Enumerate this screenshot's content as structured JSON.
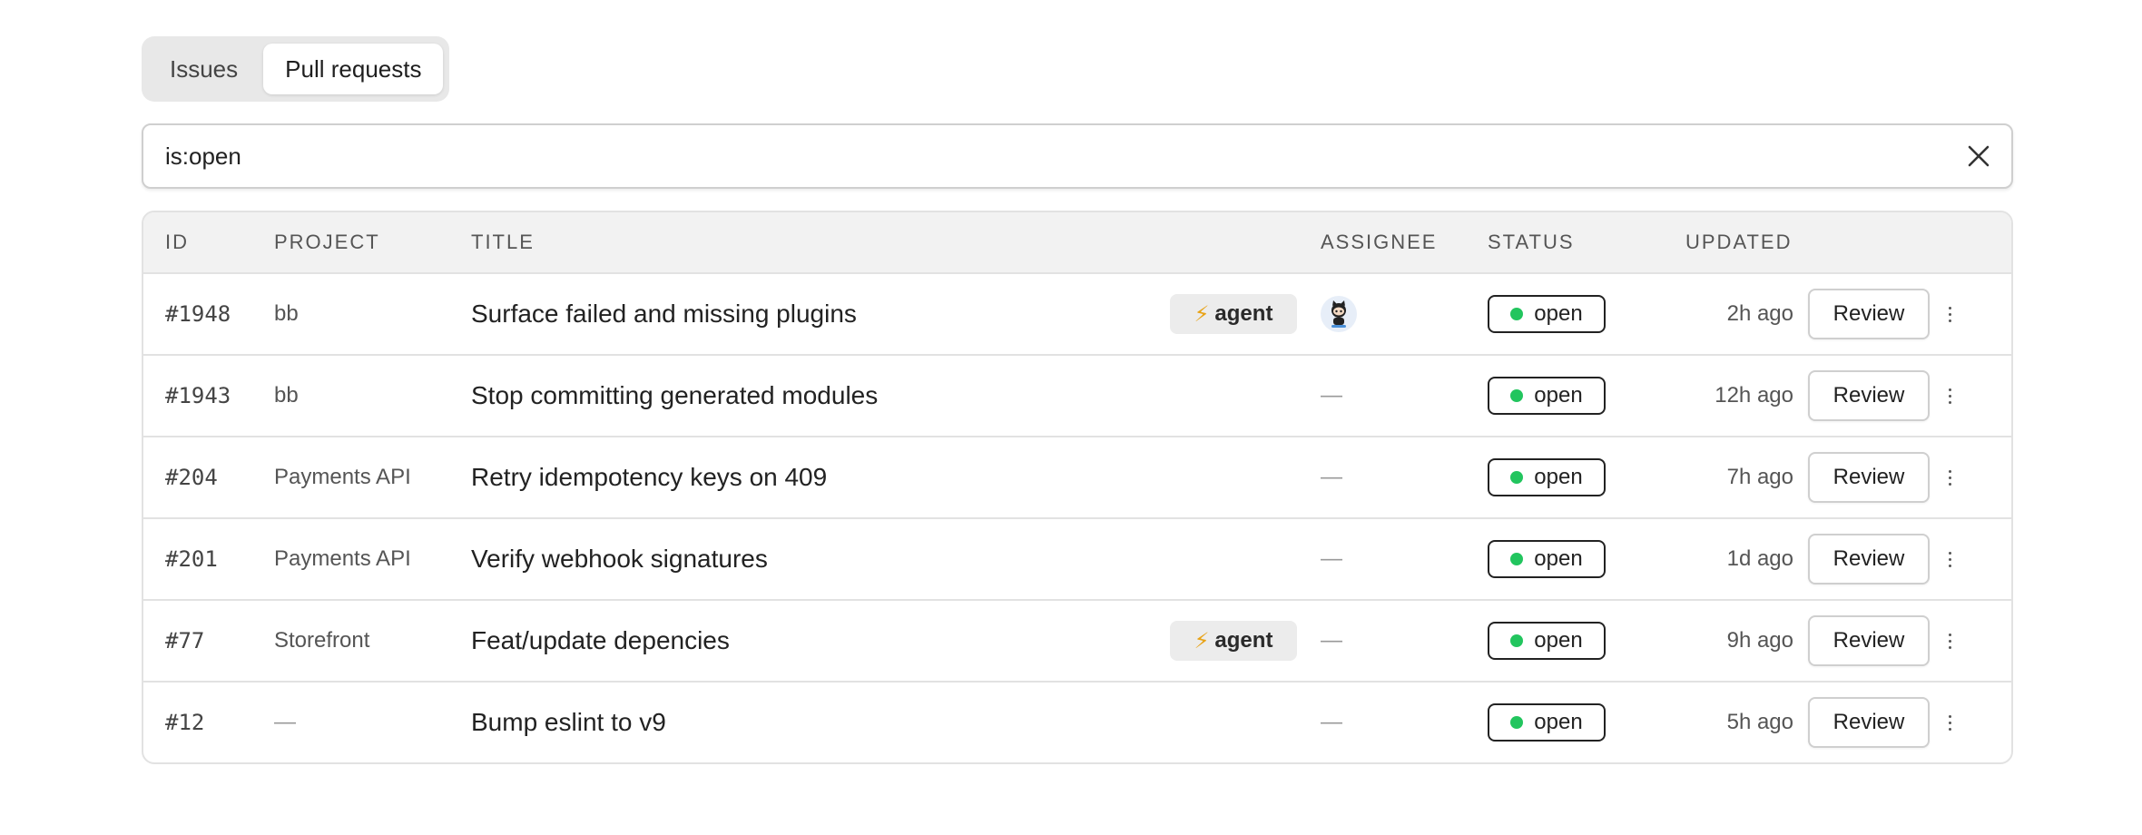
{
  "tabs": [
    {
      "label": "Issues",
      "active": false
    },
    {
      "label": "Pull requests",
      "active": true
    }
  ],
  "search": {
    "value": "is:open",
    "clear_icon": "close-icon"
  },
  "table": {
    "headers": {
      "id": "ID",
      "project": "PROJECT",
      "title": "TITLE",
      "assignee": "ASSIGNEE",
      "status": "STATUS",
      "updated": "UPDATED"
    },
    "rows": [
      {
        "id": "#1948",
        "project": "bb",
        "title": "Surface failed and missing plugins",
        "badge": "agent",
        "assignee": "avatar",
        "status": "open",
        "updated": "2h ago",
        "action": "Review"
      },
      {
        "id": "#1943",
        "project": "bb",
        "title": "Stop committing generated modules",
        "badge": "",
        "assignee": "—",
        "status": "open",
        "updated": "12h ago",
        "action": "Review"
      },
      {
        "id": "#204",
        "project": "Payments API",
        "title": "Retry idempotency keys on 409",
        "badge": "",
        "assignee": "—",
        "status": "open",
        "updated": "7h ago",
        "action": "Review"
      },
      {
        "id": "#201",
        "project": "Payments API",
        "title": "Verify webhook signatures",
        "badge": "",
        "assignee": "—",
        "status": "open",
        "updated": "1d ago",
        "action": "Review"
      },
      {
        "id": "#77",
        "project": "Storefront",
        "title": "Feat/update depencies",
        "badge": "agent",
        "assignee": "—",
        "status": "open",
        "updated": "9h ago",
        "action": "Review"
      },
      {
        "id": "#12",
        "project": "—",
        "title": "Bump eslint to v9",
        "badge": "",
        "assignee": "—",
        "status": "open",
        "updated": "5h ago",
        "action": "Review"
      }
    ]
  },
  "badge_icon": "⚡",
  "colors": {
    "status_open": "#22c55e",
    "badge_bolt": "#e8a317"
  }
}
